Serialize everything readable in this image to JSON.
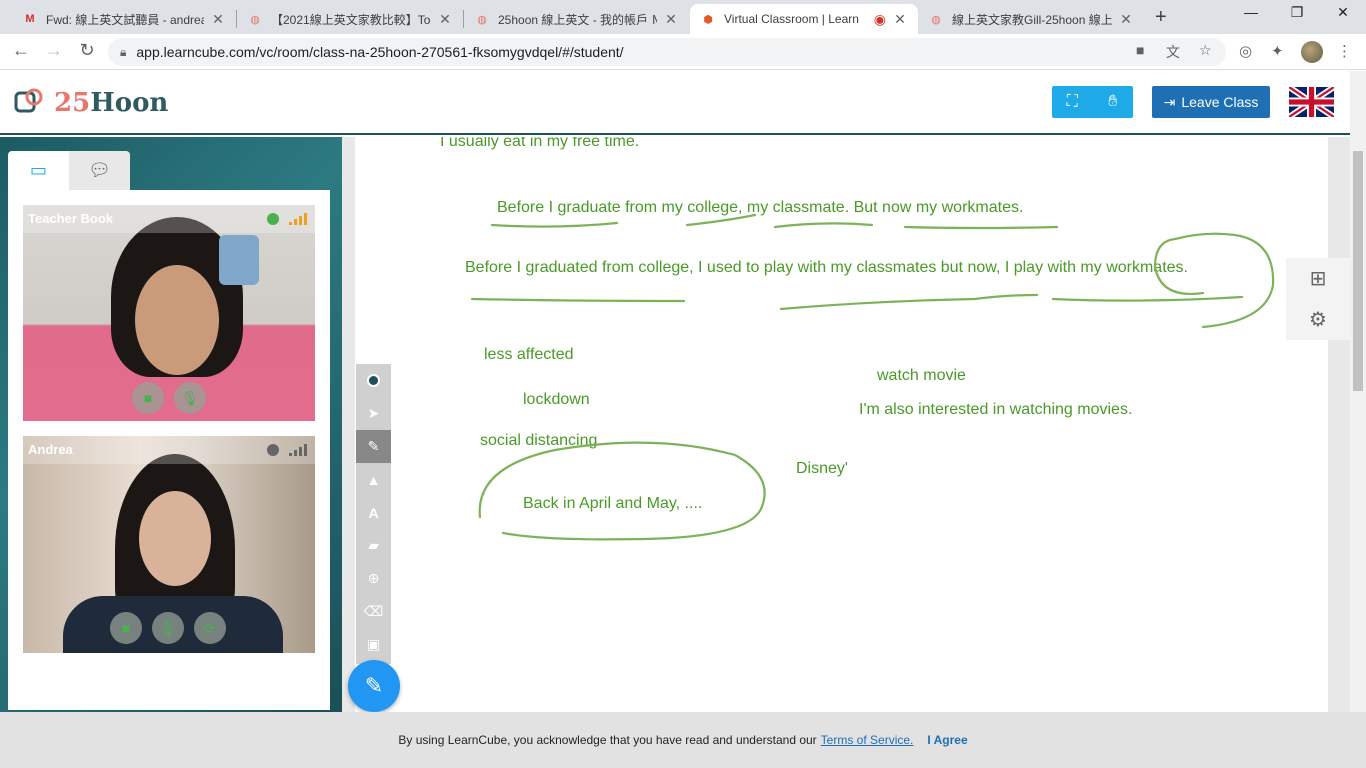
{
  "browser": {
    "tabs": [
      {
        "title": "Fwd: 線上英文試聽員 - andrea",
        "favicon": "gmail-icon"
      },
      {
        "title": "【2021線上英文家教比較】To",
        "favicon": "25hoon-icon"
      },
      {
        "title": "25hoon 線上英文 - 我的帳戶 Ｍ",
        "favicon": "25hoon-icon"
      },
      {
        "title": "Virtual Classroom | Learn",
        "favicon": "learncube-icon"
      },
      {
        "title": "線上英文家教Gill-25hoon 線上",
        "favicon": "25hoon-icon"
      }
    ],
    "url": "app.learncube.com/vc/room/class-na-25hoon-270561-fksomygvdqel/#/student/"
  },
  "header": {
    "logo_num": "25",
    "logo_word": "Hoon",
    "leave_label": "Leave Class"
  },
  "participants": [
    {
      "name": "Teacher Book",
      "status_color": "#4caf50"
    },
    {
      "name": "Andrea",
      "status_color": "#666666"
    }
  ],
  "whiteboard": {
    "lines": [
      "I usually eat in my free time.",
      "Before I graduate from my college, my classmate. But now my workmates.",
      "Before I graduated from college, I used to play with my classmates but now, I play with my workmates.",
      "less affected",
      "lockdown",
      "social distancing",
      "Back in April and May, ....",
      "watch movie",
      "I'm also interested in watching movies.",
      "Disney'"
    ],
    "ink_color": "#4a9a28"
  },
  "consent": {
    "text": "By using LearnCube, you acknowledge that you have read and understand our",
    "link": "Terms of Service.",
    "agree": "I Agree"
  }
}
